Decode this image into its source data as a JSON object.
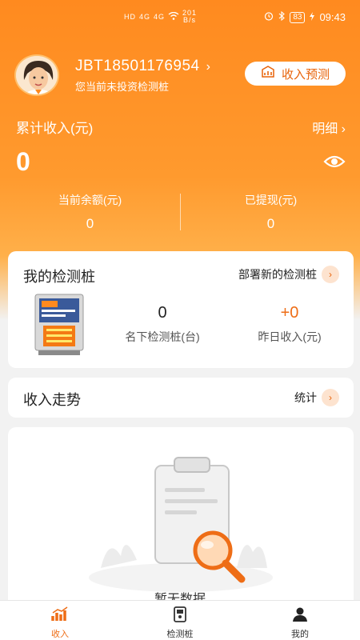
{
  "status_bar": {
    "network_left": "HD",
    "network_right": "HD",
    "signal_a": "4G",
    "signal_b": "4G",
    "speed_value": "201",
    "speed_unit": "B/s",
    "battery": "83",
    "time": "09:43"
  },
  "profile": {
    "account": "JBT18501176954",
    "subtitle": "您当前未投资检测桩",
    "forecast_button": "收入预测"
  },
  "income": {
    "cumulative_label": "累计收入(元)",
    "detail_link": "明细",
    "cumulative_value": "0",
    "balance_label": "当前余额(元)",
    "balance_value": "0",
    "withdrawn_label": "已提现(元)",
    "withdrawn_value": "0"
  },
  "my_piles": {
    "title": "我的检测桩",
    "deploy_link": "部署新的检测桩",
    "owned_count": "0",
    "owned_label": "名下检测桩(台)",
    "yesterday_income": "+0",
    "yesterday_label": "昨日收入(元)",
    "accent_color": "#ee6d16"
  },
  "trend": {
    "title": "收入走势",
    "stats_link": "统计",
    "empty_text": "暂无数据"
  },
  "tabbar": {
    "tabs": [
      {
        "label": "收入",
        "icon": "bar-chart-icon",
        "active": true
      },
      {
        "label": "检测桩",
        "icon": "kiosk-icon",
        "active": false
      },
      {
        "label": "我的",
        "icon": "person-icon",
        "active": false
      }
    ]
  },
  "colors": {
    "brand_orange": "#ff8a1f",
    "accent": "#ee6d16"
  }
}
